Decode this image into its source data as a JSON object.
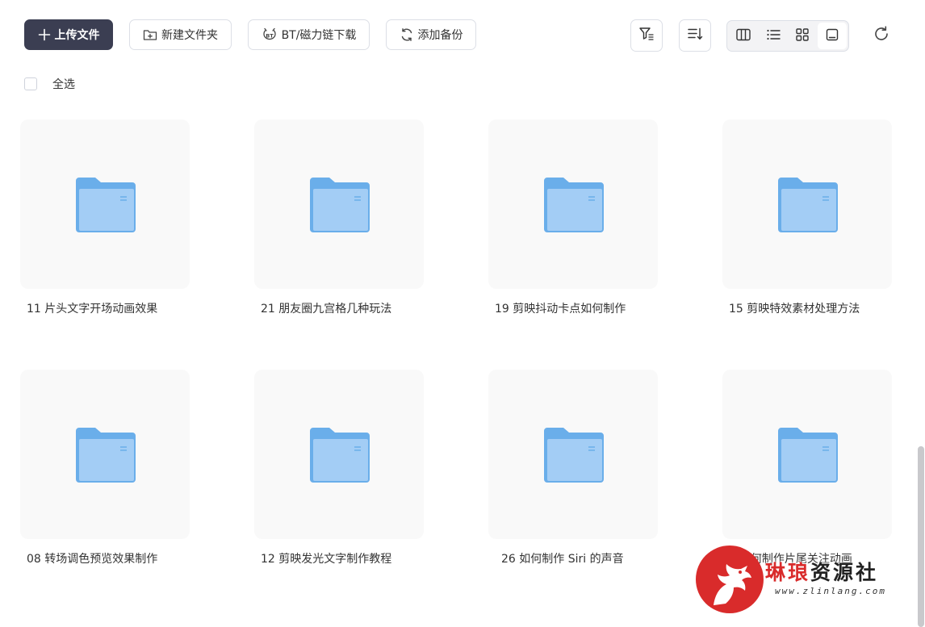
{
  "toolbar": {
    "upload_label": "上传文件",
    "new_folder_label": "新建文件夹",
    "bt_label": "BT/磁力链下载",
    "backup_label": "添加备份",
    "icons": {
      "upload": "plus-icon",
      "new_folder": "folder-plus-icon",
      "bt": "bt-icon",
      "backup": "sync-icon",
      "filter": "filter-icon",
      "sort": "sort-icon",
      "refresh": "refresh-icon"
    },
    "views": [
      {
        "icon": "columns-view-icon",
        "active": false
      },
      {
        "icon": "list-view-icon",
        "active": false
      },
      {
        "icon": "grid-view-icon",
        "active": false
      },
      {
        "icon": "preview-view-icon",
        "active": true
      }
    ],
    "primary_color": "#3b3e52"
  },
  "select_all_label": "全选",
  "folders": [
    {
      "name": "11 片头文字开场动画效果"
    },
    {
      "name": "21 朋友圈九宫格几种玩法"
    },
    {
      "name": "19 剪映抖动卡点如何制作"
    },
    {
      "name": "15 剪映特效素材处理方法"
    },
    {
      "name": "08 转场调色预览效果制作"
    },
    {
      "name": "12 剪映发光文字制作教程"
    },
    {
      "name": "26 如何制作 Siri 的声音"
    },
    {
      "name": "0何制作片尾关注动画"
    }
  ],
  "folder_icon": "folder-icon",
  "folder_color": "#6aaeea",
  "watermark": {
    "title_part1": "琳琅",
    "title_part2": "资源社",
    "url": "www.zlinlang.com",
    "accent": "#d92b2b"
  }
}
